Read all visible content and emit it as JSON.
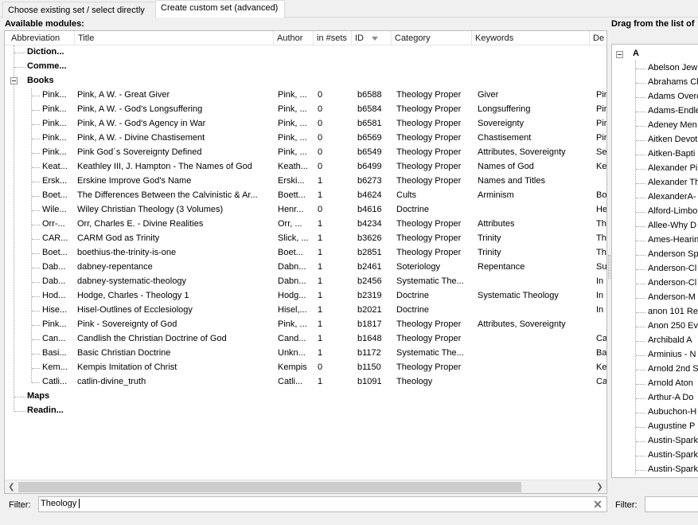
{
  "tabs": [
    {
      "label": "Choose existing set / select directly"
    },
    {
      "label": "Create custom set (advanced)"
    }
  ],
  "left_panel": {
    "title": "Available modules:",
    "columns": [
      "Abbreviation",
      "Title",
      "Author",
      "in #sets",
      "ID",
      "Category",
      "Keywords",
      "De"
    ],
    "groups": {
      "dictionaries": "Diction...",
      "commentaries": "Comme...",
      "books": "Books",
      "maps": "Maps",
      "reading": "Readin..."
    },
    "books": [
      {
        "abbr": "Pink...",
        "title": "Pink, A W. - Great Giver",
        "author": "Pink, ...",
        "sets": "0",
        "id": "b6588",
        "category": "Theology Proper",
        "keywords": "Giver",
        "desc": "Pir"
      },
      {
        "abbr": "Pink...",
        "title": "Pink, A W. - God's Longsuffering",
        "author": "Pink, ...",
        "sets": "0",
        "id": "b6584",
        "category": "Theology Proper",
        "keywords": "Longsuffering",
        "desc": "Pir"
      },
      {
        "abbr": "Pink...",
        "title": "Pink, A W. - God's Agency in War",
        "author": "Pink, ...",
        "sets": "0",
        "id": "b6581",
        "category": "Theology Proper",
        "keywords": "Sovereignty",
        "desc": "Pir"
      },
      {
        "abbr": "Pink...",
        "title": "Pink, A W. - Divine Chastisement",
        "author": "Pink, ...",
        "sets": "0",
        "id": "b6569",
        "category": "Theology Proper",
        "keywords": "Chastisement",
        "desc": "Pir"
      },
      {
        "abbr": "Pink...",
        "title": "Pink God´s Sovereignty Defined",
        "author": "Pink, ...",
        "sets": "0",
        "id": "b6549",
        "category": "Theology Proper",
        "keywords": "Attributes, Sovereignty",
        "desc": "Se"
      },
      {
        "abbr": "Keat...",
        "title": "Keathley III, J. Hampton - The Names of God",
        "author": "Keath...",
        "sets": "0",
        "id": "b6499",
        "category": "Theology Proper",
        "keywords": "Names of God",
        "desc": "Ke"
      },
      {
        "abbr": "Ersk...",
        "title": "Erskine Improve God's Name",
        "author": "Erski...",
        "sets": "1",
        "id": "b6273",
        "category": "Theology Proper",
        "keywords": "Names and Titles",
        "desc": ""
      },
      {
        "abbr": "Boet...",
        "title": "The Differences Between the Calvinistic & Ar...",
        "author": "Boett...",
        "sets": "1",
        "id": "b4624",
        "category": "Cults",
        "keywords": "Arminism",
        "desc": "Bo"
      },
      {
        "abbr": "Wile...",
        "title": "Wiley Christian Theology (3 Volumes)",
        "author": "Henr...",
        "sets": "0",
        "id": "b4616",
        "category": "Doctrine",
        "keywords": "",
        "desc": "He"
      },
      {
        "abbr": "Orr-...",
        "title": "Orr, Charles E. -  Divine Realities",
        "author": "Orr, ...",
        "sets": "1",
        "id": "b4234",
        "category": "Theology Proper",
        "keywords": "Attributes",
        "desc": "Th"
      },
      {
        "abbr": "CAR...",
        "title": "CARM God as Trinity",
        "author": "Slick, ...",
        "sets": "1",
        "id": "b3626",
        "category": "Theology Proper",
        "keywords": "Trinity",
        "desc": "Th"
      },
      {
        "abbr": "Boet...",
        "title": "boethius-the-trinity-is-one",
        "author": "Boet...",
        "sets": "1",
        "id": "b2851",
        "category": "Theology Proper",
        "keywords": "Trinity",
        "desc": "Th"
      },
      {
        "abbr": "Dab...",
        "title": "dabney-repentance",
        "author": "Dabn...",
        "sets": "1",
        "id": "b2461",
        "category": "Soteriology",
        "keywords": "Repentance",
        "desc": "Su"
      },
      {
        "abbr": "Dab...",
        "title": "dabney-systematic-theology",
        "author": "Dabn...",
        "sets": "1",
        "id": "b2456",
        "category": "Systematic The...",
        "keywords": "",
        "desc": "In"
      },
      {
        "abbr": "Hod...",
        "title": "Hodge, Charles - Theology 1",
        "author": "Hodg...",
        "sets": "1",
        "id": "b2319",
        "category": "Doctrine",
        "keywords": "Systematic Theology",
        "desc": "In"
      },
      {
        "abbr": "Hise...",
        "title": "Hisel-Outlines of Ecclesiology",
        "author": "Hisel,...",
        "sets": "1",
        "id": "b2021",
        "category": "Doctrine",
        "keywords": "",
        "desc": "In"
      },
      {
        "abbr": "Pink...",
        "title": "Pink - Sovereignty of God",
        "author": "Pink, ...",
        "sets": "1",
        "id": "b1817",
        "category": "Theology Proper",
        "keywords": "Attributes, Sovereignty",
        "desc": ""
      },
      {
        "abbr": "Can...",
        "title": "Candlish the Christian Doctrine of God",
        "author": "Cand...",
        "sets": "1",
        "id": "b1648",
        "category": "Theology Proper",
        "keywords": "",
        "desc": "Ca"
      },
      {
        "abbr": "Basi...",
        "title": "Basic Christian Doctrine",
        "author": "Unkn...",
        "sets": "1",
        "id": "b1172",
        "category": "Systematic The...",
        "keywords": "",
        "desc": "Ba"
      },
      {
        "abbr": "Kem...",
        "title": "Kempis Imitation of Christ",
        "author": "Kempis",
        "sets": "0",
        "id": "b1150",
        "category": "Theology Proper",
        "keywords": "",
        "desc": "Ke"
      },
      {
        "abbr": "Catli...",
        "title": "catlin-divine_truth",
        "author": "Catli...",
        "sets": "1",
        "id": "b1091",
        "category": "Theology",
        "keywords": "",
        "desc": "Ca"
      }
    ],
    "filter_label": "Filter:",
    "filter_value": "Theology"
  },
  "right_panel": {
    "title": "Drag from the list of",
    "group": "A",
    "items": [
      "Abelson Jew",
      "Abrahams Cl",
      "Adams Overc",
      "Adams-Endle",
      "Adeney Men",
      "Aitken Devot",
      "Aitken-Bapti",
      "Alexander Pi",
      "Alexander Th",
      "AlexanderA-",
      "Alford-Limbo",
      "Allee-Why D",
      "Ames-Hearin",
      "Anderson Sp",
      "Anderson-Cl",
      "Anderson-Cl",
      "Anderson-M",
      "anon 101 Re",
      "Anon 250 Ev",
      "Archibald A",
      "Arminius - N",
      "Arnold 2nd S",
      "Arnold Aton",
      "Arthur-A Do",
      "Aubuchon-H",
      "Augustine P",
      "Austin-Spark",
      "Austin-Spark",
      "Austin-Spark"
    ],
    "filter_label": "Filter:",
    "filter_value": ""
  },
  "icons": {
    "clear": "clear-x-icon",
    "collapse": "minus-box-icon",
    "sort": "sort-desc-icon"
  }
}
